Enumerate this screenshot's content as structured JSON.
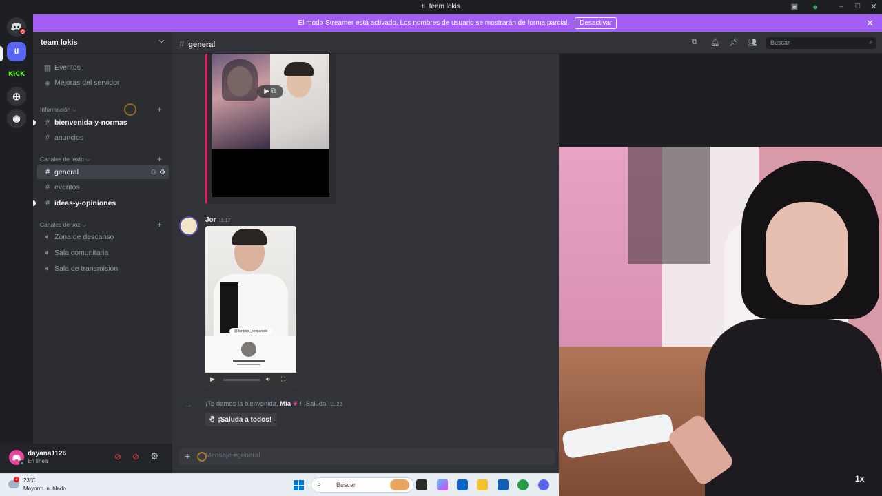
{
  "window": {
    "title": "team lokis"
  },
  "banner": {
    "text": "El modo Streamer está activado. Los nombres de usuario se mostrarán de forma parcial.",
    "button": "Desactivar"
  },
  "rail": {
    "badge": "9",
    "server_initials": "tl",
    "kick": "KICK"
  },
  "server": {
    "name": "team lokis"
  },
  "sidebar": {
    "top_items": [
      {
        "label": "Eventos",
        "icon": "calendar-icon"
      },
      {
        "label": "Mejoras del servidor",
        "icon": "boost-icon"
      }
    ],
    "categories": [
      {
        "label": "Información",
        "channels": [
          {
            "label": "bienvenida-y-normas",
            "unread": true
          },
          {
            "label": "anuncios",
            "unread": false
          }
        ]
      },
      {
        "label": "Canales de texto",
        "channels": [
          {
            "label": "general",
            "active": true
          },
          {
            "label": "eventos",
            "unread": false
          },
          {
            "label": "ideas-y-opiniones",
            "unread": true
          }
        ]
      },
      {
        "label": "Canales de voz",
        "channels": [
          {
            "label": "Zona de descanso"
          },
          {
            "label": "Sala comunitaria"
          },
          {
            "label": "Sala de transmisión"
          }
        ]
      }
    ]
  },
  "user": {
    "name": "dayana1126",
    "status": "En línea"
  },
  "channel": {
    "name": "general",
    "search_placeholder": "Buscar"
  },
  "messages": {
    "author": "Jor",
    "time": "11:17",
    "video_caption": "@Junpapi_bloquendo",
    "welcome_prefix": "¡Te damos la bienvenida,",
    "welcome_name": "Mia",
    "welcome_suffix": "! ¡Saluda!",
    "welcome_time": "11:23",
    "wave_button": "¡Saluda a todos!"
  },
  "composer": {
    "placeholder": "Mensaje #general"
  },
  "cam": {
    "zoom": "1x"
  },
  "taskbar": {
    "weather_temp": "23°C",
    "weather_desc": "Mayorm. nublado",
    "search": "Buscar"
  },
  "colors": {
    "accent": "#a35ff5",
    "active_channel": "#404249",
    "embed_border": "#e91e63"
  }
}
